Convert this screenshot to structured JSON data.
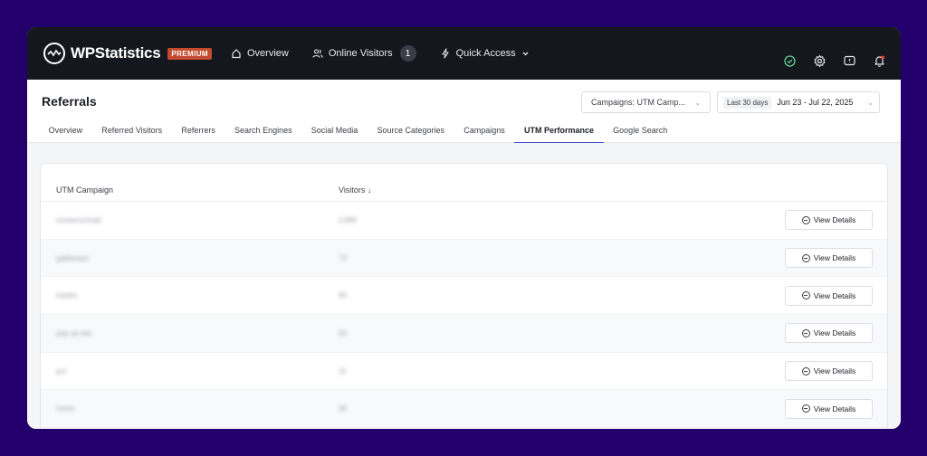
{
  "app": {
    "logo_text": "WPStatistics",
    "badge": "PREMIUM"
  },
  "nav": {
    "overview": "Overview",
    "online_visitors": "Online Visitors",
    "online_count": "1",
    "quick_access": "Quick Access"
  },
  "icons": {
    "logo": "wave-logo-icon",
    "home": "home-icon",
    "users": "users-icon",
    "bolt": "bolt-icon",
    "shield": "shield-check-icon",
    "gear": "gear-icon",
    "feedback": "feedback-icon",
    "bell": "bell-icon",
    "view": "minus-circle-icon"
  },
  "colors": {
    "accent": "#4b51d4",
    "badge": "#c44b2f",
    "topbar": "#15171f",
    "notification": "#e0473a"
  },
  "page": {
    "title": "Referrals"
  },
  "filters": {
    "campaign": "Campaigns: UTM Camp...",
    "date_chip": "Last 30 days",
    "date_range": "Jun 23 - Jul 22, 2025"
  },
  "tabs": [
    "Overview",
    "Referred Visitors",
    "Referrers",
    "Search Engines",
    "Social Media",
    "Source Categories",
    "Campaigns",
    "UTM Performance",
    "Google Search"
  ],
  "active_tab": "UTM Performance",
  "table": {
    "headers": {
      "campaign": "UTM Campaign",
      "visitors": "Visitors ↓"
    },
    "view_label": "View Details",
    "rows": [
      {
        "campaign": "renewcontrakt",
        "visitors": "2,896"
      },
      {
        "campaign": "gadeways",
        "visitors": "73"
      },
      {
        "campaign": "hawke",
        "visitors": "66"
      },
      {
        "campaign": "pop up site",
        "visitors": "63"
      },
      {
        "campaign": "pro",
        "visitors": "31"
      },
      {
        "campaign": "home",
        "visitors": "30"
      }
    ]
  }
}
